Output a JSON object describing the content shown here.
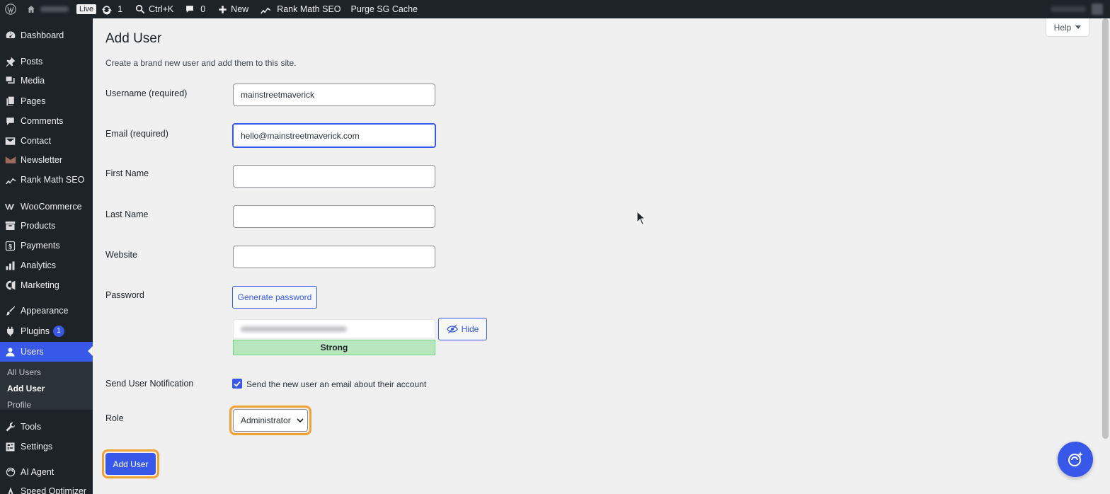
{
  "adminbar": {
    "live_label": "Live",
    "updates_count": "1",
    "search_shortcut": "Ctrl+K",
    "comments_count": "0",
    "new_label": "New",
    "rank_math_label": "Rank Math SEO",
    "purge_label": "Purge SG Cache"
  },
  "sidebar": {
    "items": [
      {
        "label": "Dashboard",
        "icon": "dashboard-icon"
      },
      {
        "label": "Posts",
        "icon": "pin-icon"
      },
      {
        "label": "Media",
        "icon": "media-icon"
      },
      {
        "label": "Pages",
        "icon": "pages-icon"
      },
      {
        "label": "Comments",
        "icon": "comment-icon"
      },
      {
        "label": "Contact",
        "icon": "envelope-icon"
      },
      {
        "label": "Newsletter",
        "icon": "newsletter-icon"
      },
      {
        "label": "Rank Math SEO",
        "icon": "rank-math-icon"
      },
      {
        "label": "WooCommerce",
        "icon": "woocommerce-icon"
      },
      {
        "label": "Products",
        "icon": "archive-icon"
      },
      {
        "label": "Payments",
        "icon": "dollar-icon"
      },
      {
        "label": "Analytics",
        "icon": "bar-chart-icon"
      },
      {
        "label": "Marketing",
        "icon": "megaphone-icon"
      },
      {
        "label": "Appearance",
        "icon": "brush-icon"
      },
      {
        "label": "Plugins",
        "icon": "plug-icon",
        "badge": "1"
      },
      {
        "label": "Users",
        "icon": "user-icon",
        "current": true
      },
      {
        "label": "Tools",
        "icon": "wrench-icon"
      },
      {
        "label": "Settings",
        "icon": "settings-icon"
      },
      {
        "label": "AI Agent",
        "icon": "ai-agent-icon"
      },
      {
        "label": "Speed Optimizer",
        "icon": "speed-icon"
      }
    ],
    "submenu": [
      {
        "label": "All Users"
      },
      {
        "label": "Add User",
        "active": true
      },
      {
        "label": "Profile"
      }
    ]
  },
  "help_label": "Help",
  "page": {
    "title": "Add User",
    "description": "Create a brand new user and add them to this site."
  },
  "form": {
    "username_label": "Username (required)",
    "username_value": "mainstreetmaverick",
    "email_label": "Email (required)",
    "email_value": "hello@mainstreetmaverick.com",
    "first_name_label": "First Name",
    "first_name_value": "",
    "last_name_label": "Last Name",
    "last_name_value": "",
    "website_label": "Website",
    "website_value": "",
    "password_label": "Password",
    "generate_password_label": "Generate password",
    "hide_label": "Hide",
    "strength_label": "Strong",
    "notification_label": "Send User Notification",
    "notification_checkbox_label": "Send the new user an email about their account",
    "notification_checked": true,
    "role_label": "Role",
    "role_value": "Administrator",
    "submit_label": "Add User"
  },
  "colors": {
    "accent": "#3858e9",
    "highlight": "#f0a232",
    "adminbar": "#1d2327",
    "strength_bg": "#b8e6bf"
  }
}
